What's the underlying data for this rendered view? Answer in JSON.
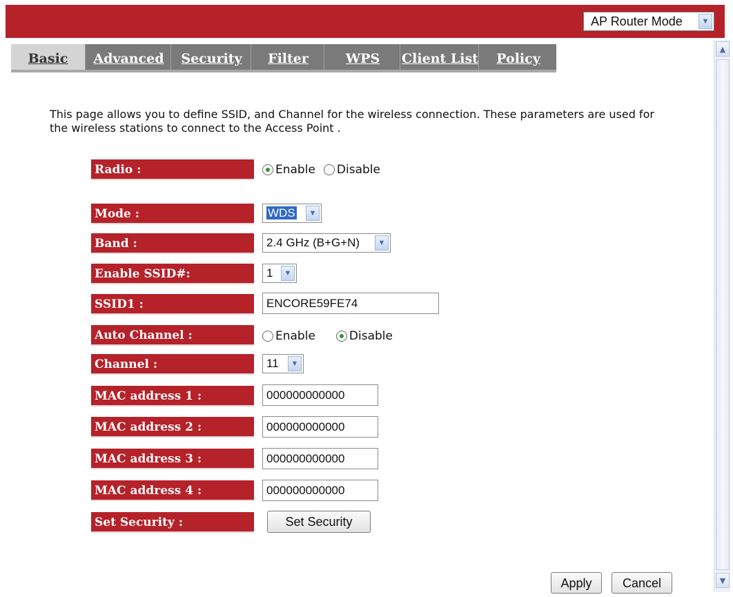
{
  "header": {
    "mode_select": "AP Router Mode",
    "brand_color": "#b5222a"
  },
  "tabs": [
    "Basic",
    "Advanced",
    "Security",
    "Filter",
    "WPS",
    "Client List",
    "Policy"
  ],
  "active_tab": "Basic",
  "description": "This page allows you to define SSID, and Channel for the wireless connection. These parameters are used for the wireless stations to connect to the Access Point .",
  "form": {
    "radio": {
      "label": "Radio :",
      "enable": "Enable",
      "disable": "Disable",
      "selected": "Enable"
    },
    "mode": {
      "label": "Mode :",
      "value": "WDS"
    },
    "band": {
      "label": "Band :",
      "value": "2.4 GHz (B+G+N)"
    },
    "enable_ssid": {
      "label": "Enable SSID#:",
      "value": "1"
    },
    "ssid1": {
      "label": "SSID1 :",
      "value": "ENCORE59FE74"
    },
    "auto_channel": {
      "label": "Auto Channel :",
      "enable": "Enable",
      "disable": "Disable",
      "selected": "Disable"
    },
    "channel": {
      "label": "Channel :",
      "value": "11"
    },
    "mac1": {
      "label": "MAC address 1 :",
      "value": "000000000000"
    },
    "mac2": {
      "label": "MAC address 2 :",
      "value": "000000000000"
    },
    "mac3": {
      "label": "MAC address 3 :",
      "value": "000000000000"
    },
    "mac4": {
      "label": "MAC address 4 :",
      "value": "000000000000"
    },
    "set_security": {
      "label": "Set Security :",
      "button": "Set Security"
    }
  },
  "actions": {
    "apply": "Apply",
    "cancel": "Cancel"
  },
  "icons": {
    "dropdown": "chevron-down-icon",
    "scroll_up": "scroll-up-arrow-icon",
    "scroll_down": "scroll-down-arrow-icon"
  }
}
